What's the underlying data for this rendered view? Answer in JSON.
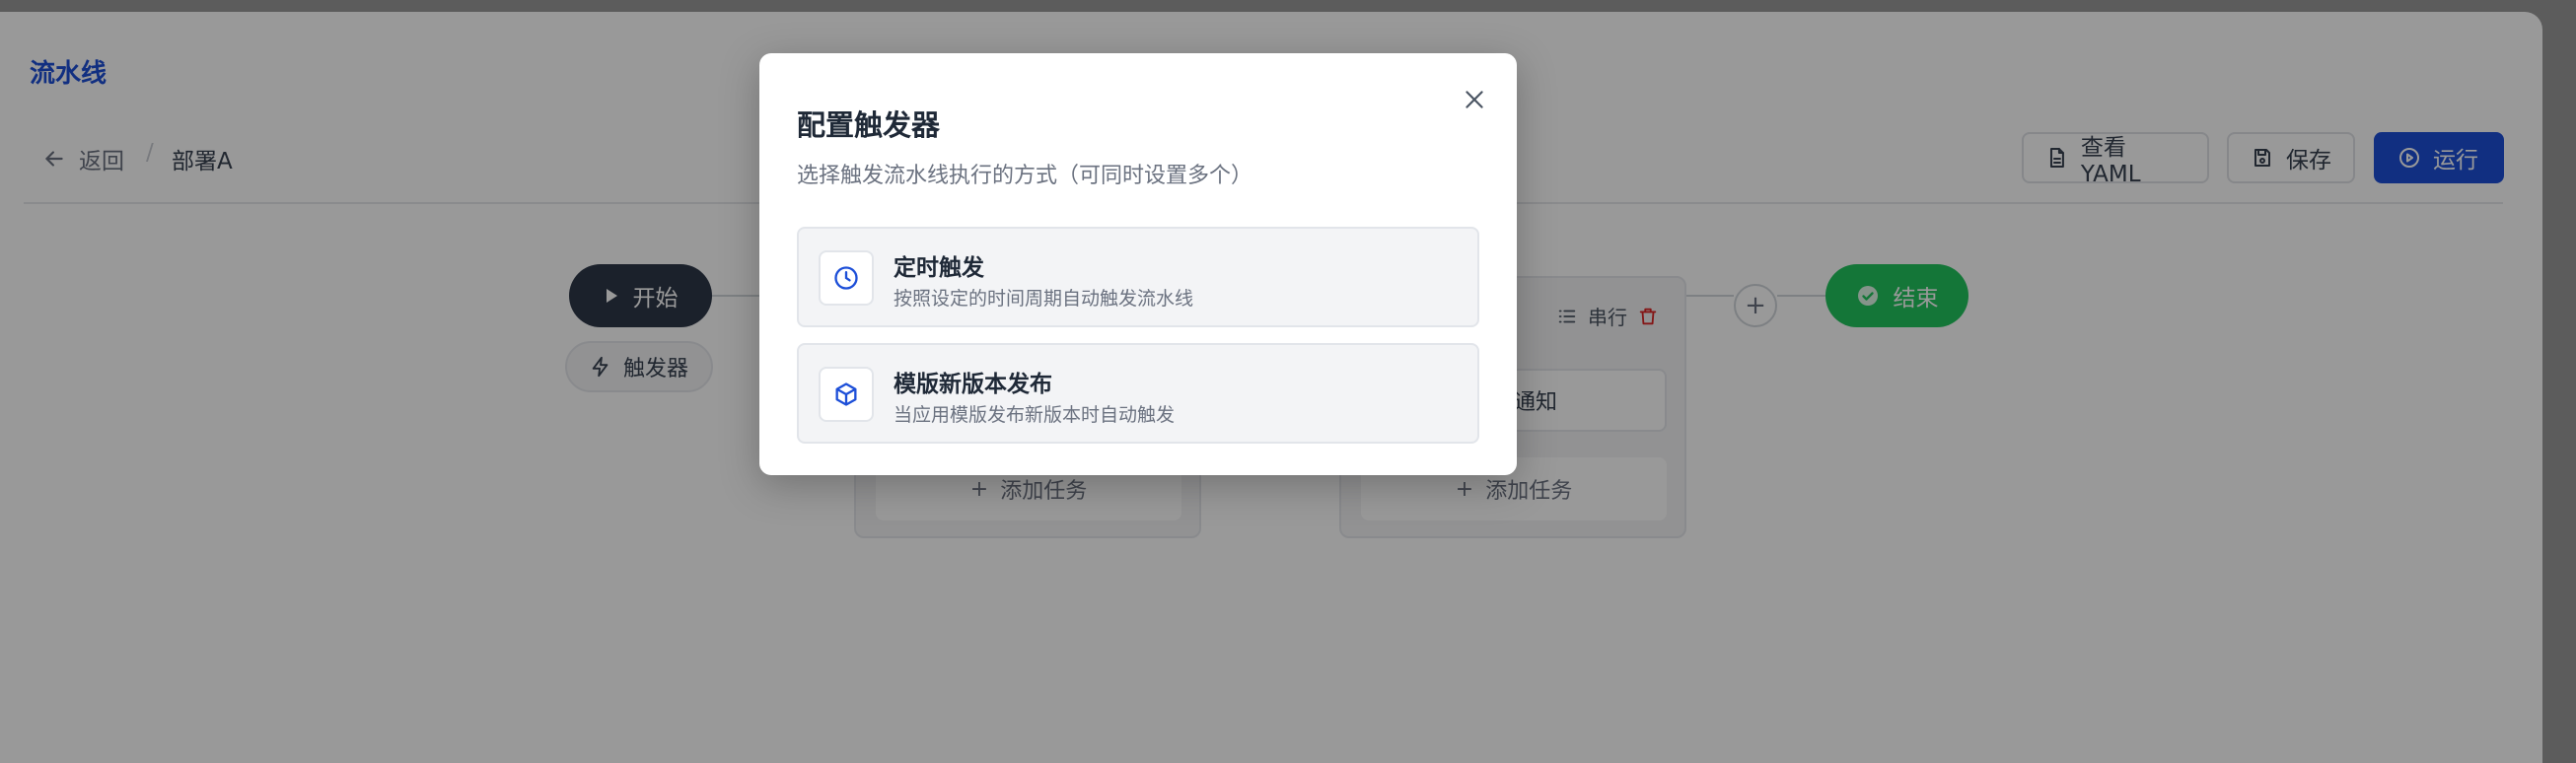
{
  "app": {
    "title": "流水线"
  },
  "breadcrumb": {
    "back_label": "返回",
    "separator": "/",
    "current": "部署A"
  },
  "toolbar": {
    "yaml_label": "查看YAML",
    "save_label": "保存",
    "run_label": "运行"
  },
  "pipeline": {
    "start_label": "开始",
    "trigger_label": "触发器",
    "end_label": "结束",
    "stage_mode_label": "串行",
    "add_task_label": "添加任务",
    "task_partial_label": "测试通知"
  },
  "modal": {
    "title": "配置触发器",
    "subtitle": "选择触发流水线执行的方式（可同时设置多个）",
    "options": [
      {
        "title": "定时触发",
        "description": "按照设定的时间周期自动触发流水线",
        "icon": "clock-icon"
      },
      {
        "title": "模版新版本发布",
        "description": "当应用模版发布新版本时自动触发",
        "icon": "cube-icon"
      }
    ]
  },
  "colors": {
    "accent": "#1d4fd8",
    "start": "#2d3748",
    "end": "#22c55e",
    "delete": "#dc2626"
  }
}
